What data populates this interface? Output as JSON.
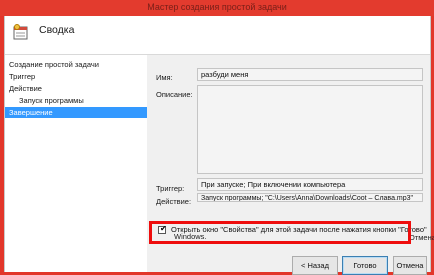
{
  "window": {
    "title": "Мастер создания простой задачи"
  },
  "header": {
    "title": "Сводка",
    "icon": "task-scheduler-icon"
  },
  "sidebar": {
    "items": [
      {
        "label": "Создание простой задачи"
      },
      {
        "label": "Триггер"
      },
      {
        "label": "Действие"
      },
      {
        "label": "Запуск программы"
      },
      {
        "label": "Завершение"
      }
    ]
  },
  "summary": {
    "name_label": "Имя:",
    "name_value": "разбуди меня",
    "description_label": "Описание:",
    "description_value": "",
    "trigger_label": "Триггер:",
    "trigger_value": "При запуске; При включении компьютера",
    "action_label": "Действие:",
    "action_value": "Запуск программы; \"C:\\Users\\Anna\\Downloads\\Coot – Слава.mp3\""
  },
  "checkbox": {
    "label": "Открыть окно \"Свойства\" для этой задачи после нажатия кнопки \"Готово\"",
    "checked": true
  },
  "hint": {
    "tail": "Отмена",
    "line2": "Windows."
  },
  "buttons": {
    "back": "< Назад",
    "finish": "Готово",
    "cancel": "Отмена"
  },
  "colors": {
    "accent": "#3399ff",
    "highlight": "#ee0d0d",
    "titlebar": "#e33b2e"
  }
}
